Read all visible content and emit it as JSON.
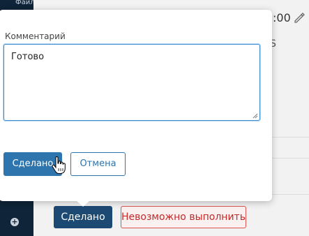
{
  "nav": {
    "files_label": "Файлы",
    "add_icon_glyph": "+"
  },
  "background": {
    "time_text": ":00",
    "partial_letter": "S",
    "done_button_label": "Сделано",
    "cannot_do_button_label": "Невозможно выполнить"
  },
  "dialog": {
    "comment_label": "Комментарий",
    "comment_value": "Готово",
    "done_button_label": "Сделано",
    "cancel_button_label": "Отмена"
  },
  "colors": {
    "nav_bg": "#0f2438",
    "primary": "#2e74ad",
    "primary_dark": "#1d4a73",
    "danger": "#c62828"
  }
}
